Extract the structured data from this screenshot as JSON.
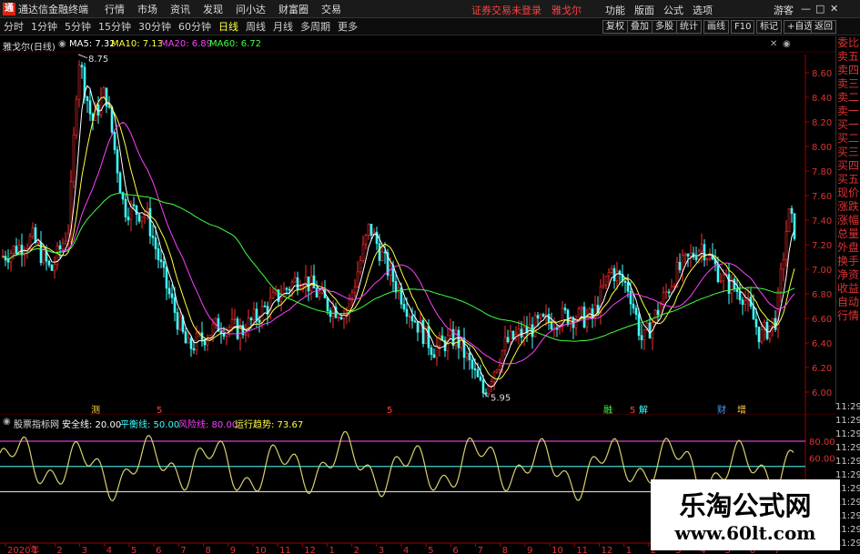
{
  "app": {
    "title": "通达信金融终端",
    "menu": [
      "行情",
      "市场",
      "资讯",
      "发现",
      "问小达",
      "财富圈",
      "交易"
    ],
    "warning": "证券交易未登录",
    "stock_name": "雅戈尔",
    "right_menu": [
      "功能",
      "版面",
      "公式",
      "选项"
    ],
    "guest": "游客"
  },
  "toolbar": {
    "periods": [
      "分时",
      "1分钟",
      "5分钟",
      "15分钟",
      "30分钟",
      "60分钟",
      "日线",
      "周线",
      "月线",
      "多周期",
      "更多"
    ],
    "active_period": "日线",
    "right_buttons": [
      "复权",
      "叠加",
      "多股",
      "统计",
      "画线",
      "F10",
      "标记",
      "+自选",
      "返回"
    ]
  },
  "main_chart": {
    "title": "雅戈尔(日线)",
    "ma": [
      {
        "label": "MA5: 7.32",
        "color": "#ffffff"
      },
      {
        "label": "MA10: 7.13",
        "color": "#ffff40"
      },
      {
        "label": "MA20: 6.89",
        "color": "#ff40ff"
      },
      {
        "label": "MA60: 6.72",
        "color": "#40ff40"
      }
    ],
    "y_ticks": [
      "8.60",
      "8.40",
      "8.20",
      "8.00",
      "7.80",
      "7.60",
      "7.40",
      "7.20",
      "7.00",
      "6.80",
      "6.60",
      "6.40",
      "6.20",
      "6.00"
    ],
    "high_label": "8.75",
    "low_label": "5.95",
    "markers": [
      {
        "text": "测",
        "color": "#ffd040"
      },
      {
        "text": "5",
        "color": "#ff4040"
      },
      {
        "text": "5",
        "color": "#ff4040"
      },
      {
        "text": "融",
        "color": "#40ff40"
      },
      {
        "text": "5",
        "color": "#ff4040"
      },
      {
        "text": "解",
        "color": "#40ffff"
      },
      {
        "text": "财",
        "color": "#40a0ff"
      },
      {
        "text": "增",
        "color": "#ffd040"
      }
    ]
  },
  "indicator": {
    "name": "股票指标网",
    "legend": [
      {
        "label": "安全线: 20.00",
        "color": "#ffffff"
      },
      {
        "label": "平衡线: 50.00",
        "color": "#40ffff"
      },
      {
        "label": "风险线: 80.00",
        "color": "#ff40ff"
      },
      {
        "label": "运行趋势: 73.67",
        "color": "#ffff40"
      }
    ],
    "y_ticks": [
      "80.00",
      "60.00"
    ]
  },
  "x_labels": [
    "2020年",
    "1",
    "2",
    "3",
    "4",
    "5",
    "6",
    "7",
    "8",
    "9",
    "10",
    "11",
    "12",
    "1",
    "2",
    "3",
    "4",
    "5",
    "6",
    "7",
    "8",
    "9",
    "10",
    "11",
    "12",
    "1",
    "2",
    "3",
    "4",
    "5",
    "6",
    "7"
  ],
  "side_panel": [
    "委比",
    "卖五",
    "卖四",
    "卖三",
    "卖二",
    "卖一",
    "买一",
    "买二",
    "买三",
    "买四",
    "买五",
    "现价",
    "涨跌",
    "涨幅",
    "总量",
    "外盘",
    "换手",
    "净资",
    "收益",
    "自动",
    "行情"
  ],
  "time_column": [
    "11:29",
    "11:29",
    "11:29",
    "11:29",
    "11:29",
    "11:29",
    "11:29",
    "11:29",
    "11:29",
    "11:29",
    "11:29"
  ],
  "watermark": {
    "title": "乐淘公式网",
    "url": "www.60lt.com"
  },
  "colors": {
    "up": "#ff3030",
    "down": "#40ffff",
    "grid": "#7a1010",
    "axis": "#a00000"
  }
}
